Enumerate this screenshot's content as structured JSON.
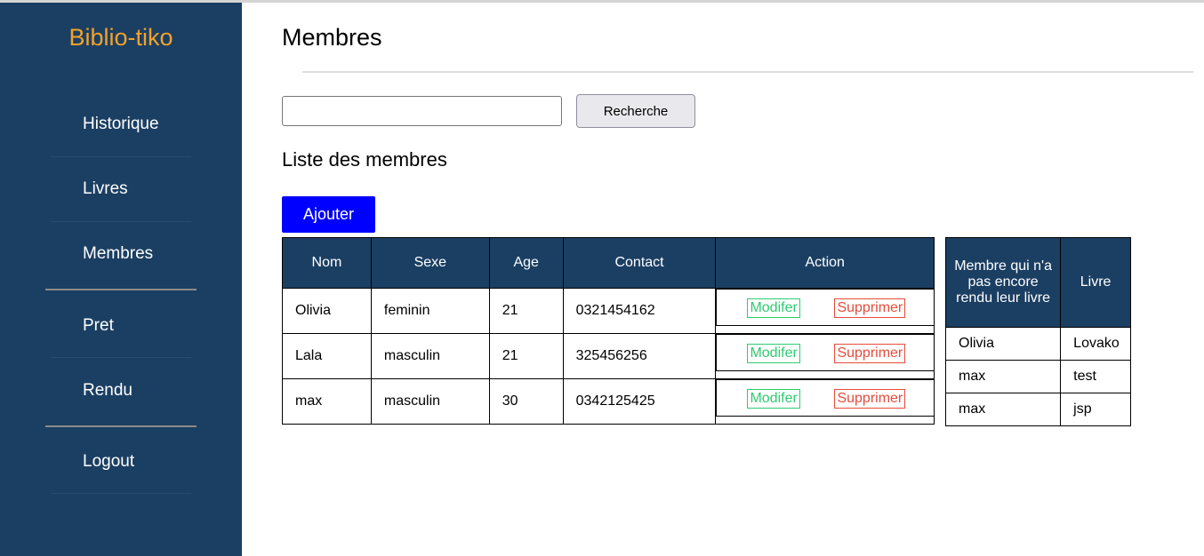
{
  "sidebar": {
    "brand": "Biblio-tiko",
    "items": [
      {
        "label": "Historique"
      },
      {
        "label": "Livres"
      },
      {
        "label": "Membres"
      },
      {
        "label": "Pret"
      },
      {
        "label": "Rendu"
      },
      {
        "label": "Logout"
      }
    ]
  },
  "header": {
    "title": "Membres"
  },
  "search": {
    "value": "",
    "placeholder": "",
    "button_label": "Recherche"
  },
  "section": {
    "title": "Liste des membres",
    "add_label": "Ajouter"
  },
  "members_table": {
    "headers": [
      "Nom",
      "Sexe",
      "Age",
      "Contact",
      "Action"
    ],
    "rows": [
      {
        "nom": "Olivia",
        "sexe": "feminin",
        "age": "21",
        "contact": "0321454162"
      },
      {
        "nom": "Lala",
        "sexe": "masculin",
        "age": "21",
        "contact": "325456256"
      },
      {
        "nom": "max",
        "sexe": "masculin",
        "age": "30",
        "contact": "0342125425"
      }
    ],
    "modify_label": "Modifer",
    "delete_label": "Supprimer"
  },
  "pending_table": {
    "headers": [
      "Membre qui n'a pas encore rendu leur livre",
      "Livre"
    ],
    "rows": [
      {
        "membre": "Olivia",
        "livre": "Lovako"
      },
      {
        "membre": "max",
        "livre": "test"
      },
      {
        "membre": "max",
        "livre": "jsp"
      }
    ]
  },
  "colors": {
    "sidebar": "#1b3f63",
    "brand": "#f2a22a",
    "add_button": "#0000ff",
    "modify": "#2ecc71",
    "delete": "#e74c3c"
  }
}
